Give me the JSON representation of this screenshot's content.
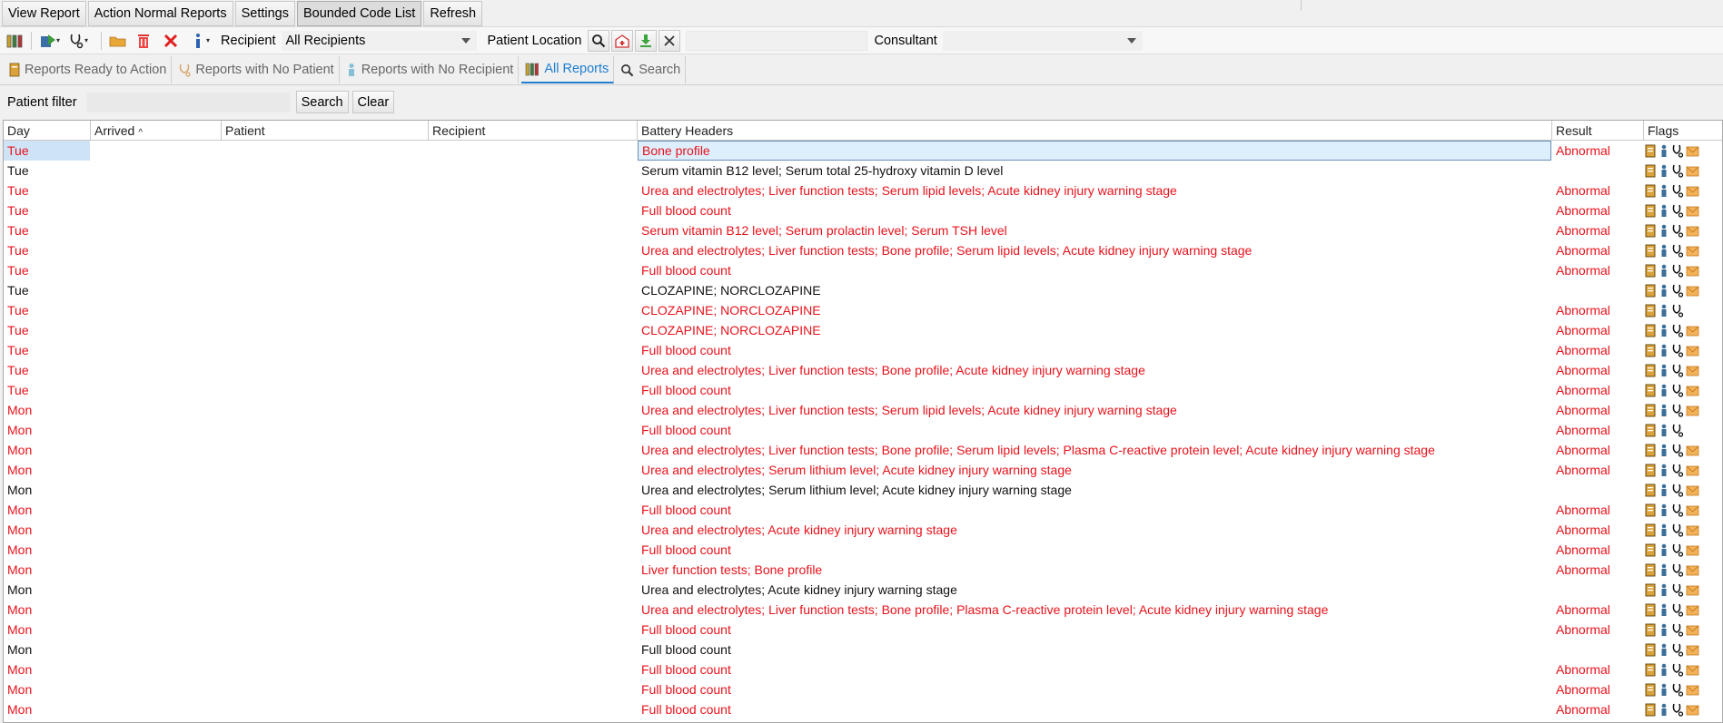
{
  "menu": {
    "view_report": "View Report",
    "action_normal": "Action Normal Reports",
    "settings": "Settings",
    "bounded_code_list": "Bounded Code List",
    "refresh": "Refresh"
  },
  "toolbar": {
    "recipient_label": "Recipient",
    "recipient_value": "All Recipients",
    "patient_location_label": "Patient Location",
    "patient_location_value": "",
    "consultant_label": "Consultant",
    "consultant_value": ""
  },
  "tabs": [
    {
      "label": "Reports Ready to Action",
      "icon": "report-ready-icon"
    },
    {
      "label": "Reports with No Patient",
      "icon": "no-patient-icon"
    },
    {
      "label": "Reports with No Recipient",
      "icon": "no-recipient-icon"
    },
    {
      "label": "All Reports",
      "icon": "all-reports-icon"
    },
    {
      "label": "Search",
      "icon": "search-icon"
    }
  ],
  "active_tab": "All Reports",
  "filter": {
    "label": "Patient filter",
    "value": "",
    "search_label": "Search",
    "clear_label": "Clear"
  },
  "table": {
    "columns": {
      "day": "Day",
      "arrived": "Arrived",
      "patient": "Patient",
      "recipient": "Recipient",
      "battery": "Battery Headers",
      "result": "Result",
      "flags": "Flags"
    },
    "sort_column": "Arrived",
    "rows": [
      {
        "day": "Tue",
        "battery": "Bone profile",
        "result": "Abnormal",
        "abnormal": true,
        "selected": true,
        "mail": true
      },
      {
        "day": "Tue",
        "battery": "Serum vitamin B12 level; Serum total 25-hydroxy vitamin D level",
        "result": "",
        "abnormal": false,
        "mail": true
      },
      {
        "day": "Tue",
        "battery": "Urea and electrolytes; Liver function tests; Serum lipid levels; Acute kidney injury warning stage",
        "result": "Abnormal",
        "abnormal": true,
        "mail": true
      },
      {
        "day": "Tue",
        "battery": "Full blood count",
        "result": "Abnormal",
        "abnormal": true,
        "mail": true
      },
      {
        "day": "Tue",
        "battery": "Serum vitamin B12 level; Serum prolactin level; Serum TSH level",
        "result": "Abnormal",
        "abnormal": true,
        "mail": true
      },
      {
        "day": "Tue",
        "battery": "Urea and electrolytes; Liver function tests; Bone profile; Serum lipid levels; Acute kidney injury warning stage",
        "result": "Abnormal",
        "abnormal": true,
        "mail": true
      },
      {
        "day": "Tue",
        "battery": "Full blood count",
        "result": "Abnormal",
        "abnormal": true,
        "mail": true
      },
      {
        "day": "Tue",
        "battery": "CLOZAPINE; NORCLOZAPINE",
        "result": "",
        "abnormal": false,
        "mail": true
      },
      {
        "day": "Tue",
        "battery": "CLOZAPINE; NORCLOZAPINE",
        "result": "Abnormal",
        "abnormal": true,
        "mail": false
      },
      {
        "day": "Tue",
        "battery": "CLOZAPINE; NORCLOZAPINE",
        "result": "Abnormal",
        "abnormal": true,
        "mail": true
      },
      {
        "day": "Tue",
        "battery": "Full blood count",
        "result": "Abnormal",
        "abnormal": true,
        "mail": true
      },
      {
        "day": "Tue",
        "battery": "Urea and electrolytes; Liver function tests; Bone profile; Acute kidney injury warning stage",
        "result": "Abnormal",
        "abnormal": true,
        "mail": true
      },
      {
        "day": "Tue",
        "battery": "Full blood count",
        "result": "Abnormal",
        "abnormal": true,
        "mail": true
      },
      {
        "day": "Mon",
        "battery": "Urea and electrolytes; Liver function tests; Serum lipid levels; Acute kidney injury warning stage",
        "result": "Abnormal",
        "abnormal": true,
        "mail": true
      },
      {
        "day": "Mon",
        "battery": "Full blood count",
        "result": "Abnormal",
        "abnormal": true,
        "mail": false
      },
      {
        "day": "Mon",
        "battery": "Urea and electrolytes; Liver function tests; Bone profile; Serum lipid levels; Plasma C-reactive protein level; Acute kidney injury warning stage",
        "result": "Abnormal",
        "abnormal": true,
        "mail": true
      },
      {
        "day": "Mon",
        "battery": "Urea and electrolytes; Serum lithium level; Acute kidney injury warning stage",
        "result": "Abnormal",
        "abnormal": true,
        "mail": true
      },
      {
        "day": "Mon",
        "battery": "Urea and electrolytes; Serum lithium level; Acute kidney injury warning stage",
        "result": "",
        "abnormal": false,
        "mail": true
      },
      {
        "day": "Mon",
        "battery": "Full blood count",
        "result": "Abnormal",
        "abnormal": true,
        "mail": true
      },
      {
        "day": "Mon",
        "battery": "Urea and electrolytes; Acute kidney injury warning stage",
        "result": "Abnormal",
        "abnormal": true,
        "mail": true
      },
      {
        "day": "Mon",
        "battery": "Full blood count",
        "result": "Abnormal",
        "abnormal": true,
        "mail": true
      },
      {
        "day": "Mon",
        "battery": "Liver function tests; Bone profile",
        "result": "Abnormal",
        "abnormal": true,
        "mail": true
      },
      {
        "day": "Mon",
        "battery": "Urea and electrolytes; Acute kidney injury warning stage",
        "result": "",
        "abnormal": false,
        "mail": true
      },
      {
        "day": "Mon",
        "battery": "Urea and electrolytes; Liver function tests; Bone profile; Plasma C-reactive protein level; Acute kidney injury warning stage",
        "result": "Abnormal",
        "abnormal": true,
        "mail": true
      },
      {
        "day": "Mon",
        "battery": "Full blood count",
        "result": "Abnormal",
        "abnormal": true,
        "mail": true
      },
      {
        "day": "Mon",
        "battery": "Full blood count",
        "result": "",
        "abnormal": false,
        "mail": true
      },
      {
        "day": "Mon",
        "battery": "Full blood count",
        "result": "Abnormal",
        "abnormal": true,
        "mail": true
      },
      {
        "day": "Mon",
        "battery": "Full blood count",
        "result": "Abnormal",
        "abnormal": true,
        "mail": true
      },
      {
        "day": "Mon",
        "battery": "Full blood count",
        "result": "Abnormal",
        "abnormal": true,
        "mail": true
      }
    ]
  },
  "colors": {
    "abnormal_text": "#e8121b",
    "active_tab": "#1f7ed0",
    "selection": "#ddeefc"
  }
}
